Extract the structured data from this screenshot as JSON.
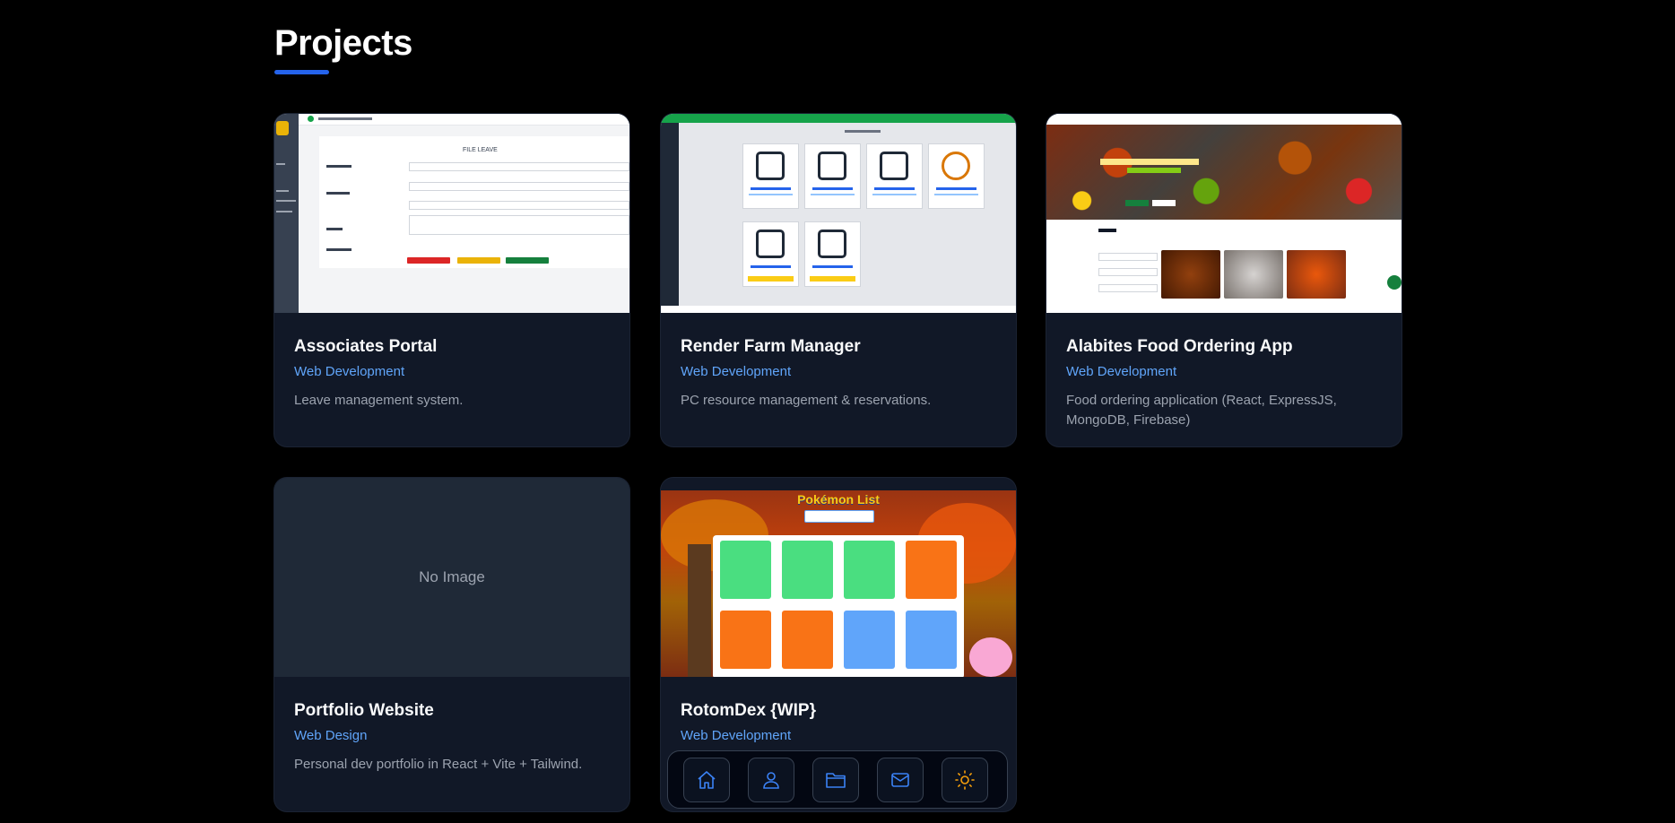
{
  "section": {
    "title": "Projects"
  },
  "projects": [
    {
      "title": "Associates Portal",
      "category": "Web Development",
      "description": "Leave management system."
    },
    {
      "title": "Render Farm Manager",
      "category": "Web Development",
      "description": "PC resource management & reservations."
    },
    {
      "title": "Alabites Food Ordering App",
      "category": "Web Development",
      "description": "Food ordering application (React, ExpressJS, MongoDB, Firebase)"
    },
    {
      "title": "Portfolio Website",
      "category": "Web Design",
      "description": "Personal dev portfolio in React + Vite + Tailwind.",
      "placeholder": "No Image"
    },
    {
      "title": "RotomDex {WIP}",
      "category": "Web Development",
      "description": ""
    }
  ],
  "dock": {
    "items": [
      {
        "icon": "home-icon"
      },
      {
        "icon": "user-icon"
      },
      {
        "icon": "folder-icon"
      },
      {
        "icon": "mail-icon"
      },
      {
        "icon": "sun-icon"
      }
    ],
    "icon_color": "#3b82f6",
    "theme_icon_color": "#f59e0b"
  },
  "colors": {
    "accent": "#2563eb",
    "category_text": "#60a5fa",
    "card_bg": "#111827",
    "page_bg": "#000000"
  },
  "thumbnails": {
    "associates": {
      "heading": "FILE LEAVE"
    },
    "rotomdex": {
      "heading": "Pokémon List"
    }
  }
}
